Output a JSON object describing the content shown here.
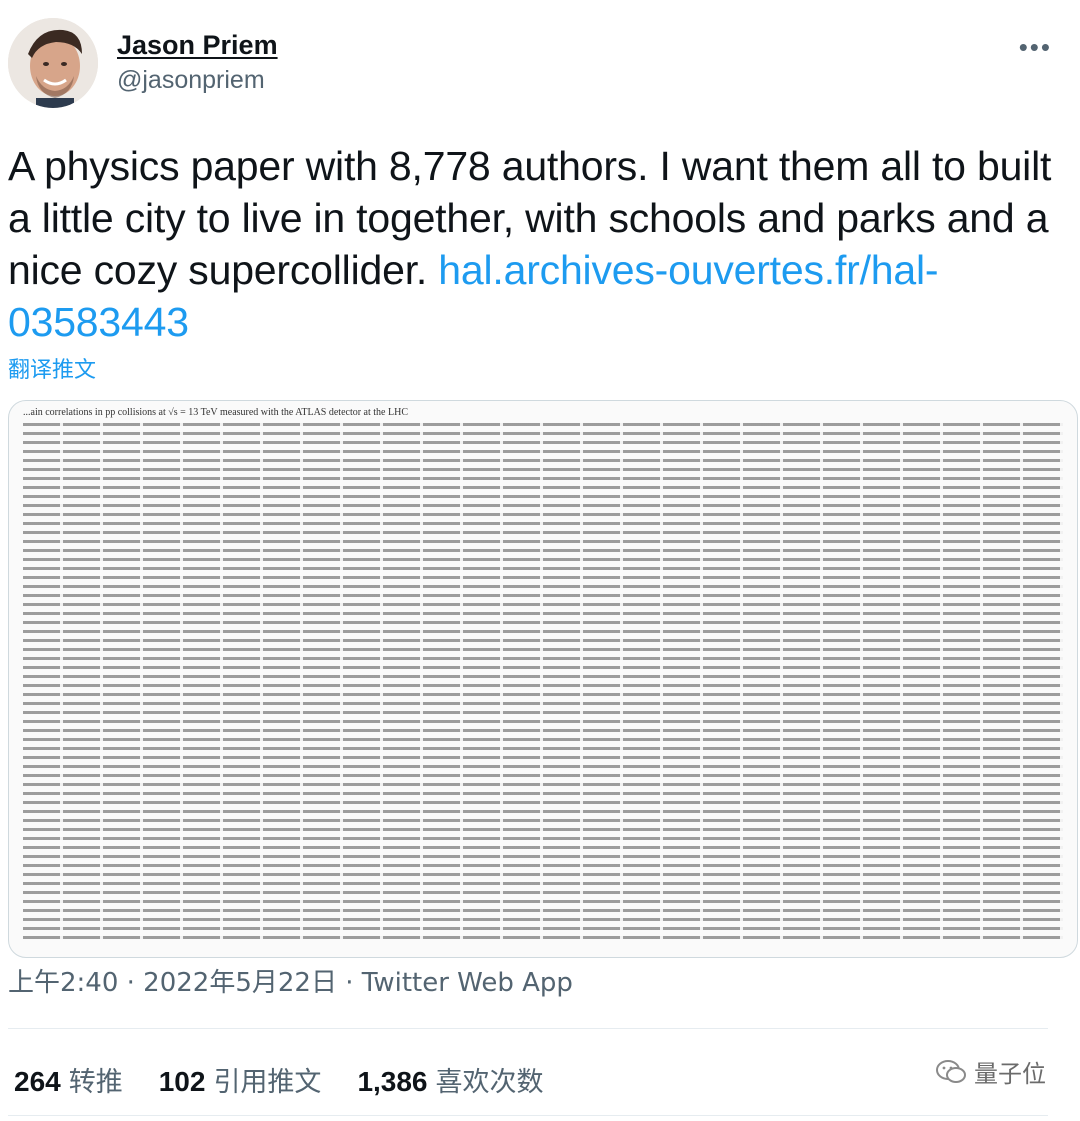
{
  "user": {
    "name": "Jason Priem",
    "handle": "@jasonpriem"
  },
  "tweet": {
    "text": "A physics paper with 8,778 authors. I want them all to built a little city to live in together, with schools and parks and a nice cozy supercollider.",
    "link": "hal.archives-ouvertes.fr/hal-03583443",
    "translate": "翻译推文",
    "timestamp": "上午2:40 · 2022年5月22日 · Twitter Web App"
  },
  "media": {
    "caption": "...ain correlations in pp collisions at √s = 13 TeV measured with the ATLAS detector at the LHC"
  },
  "stats": {
    "retweets_count": "264",
    "retweets_label": "转推",
    "quotes_count": "102",
    "quotes_label": "引用推文",
    "likes_count": "1,386",
    "likes_label": "喜欢次数"
  },
  "watermark": {
    "text": "量子位"
  },
  "colors": {
    "link": "#1d9bf0",
    "secondary": "#536471",
    "primary": "#0f1419"
  }
}
